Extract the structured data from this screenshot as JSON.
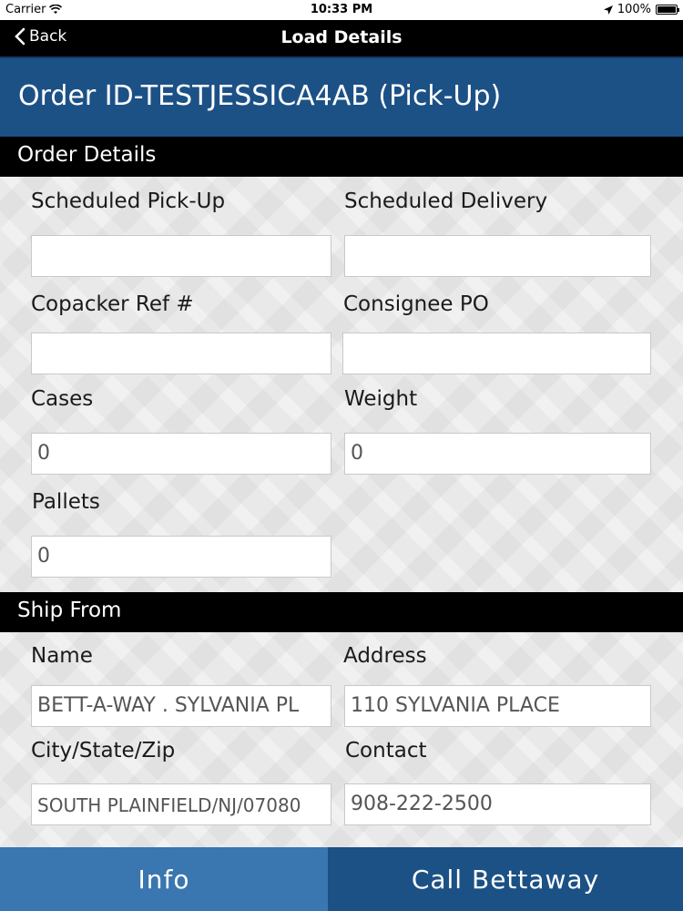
{
  "status_bar": {
    "carrier": "Carrier",
    "time": "10:33 PM",
    "battery": "100%",
    "battery_level": 1.0
  },
  "nav": {
    "back_label": "Back",
    "title": "Load Details"
  },
  "order": {
    "title": "Order ID-TESTJESSICA4AB  (Pick-Up)"
  },
  "order_details": {
    "header": "Order Details",
    "scheduled_pickup": {
      "label": "Scheduled Pick-Up",
      "value": ""
    },
    "scheduled_delivery": {
      "label": "Scheduled Delivery",
      "value": ""
    },
    "copacker_ref": {
      "label": "Copacker Ref #",
      "value": ""
    },
    "consignee_po": {
      "label": "Consignee PO",
      "value": ""
    },
    "cases": {
      "label": "Cases",
      "value": "0"
    },
    "weight": {
      "label": "Weight",
      "value": "0"
    },
    "pallets": {
      "label": "Pallets",
      "value": "0"
    }
  },
  "ship_from": {
    "header": "Ship From",
    "name": {
      "label": "Name",
      "value": "BETT-A-WAY .  SYLVANIA PL"
    },
    "address": {
      "label": "Address",
      "value": "110 SYLVANIA PLACE"
    },
    "city_state_zip": {
      "label": "City/State/Zip",
      "value": "SOUTH PLAINFIELD/NJ/07080"
    },
    "contact": {
      "label": "Contact",
      "value": "908-222-2500"
    }
  },
  "tabs": {
    "info": "Info",
    "call": "Call Bettaway"
  },
  "icons": [
    "wifi-icon",
    "location-arrow-icon",
    "battery-icon",
    "chevron-left-icon"
  ],
  "colors": {
    "header_blue": "#1c5186",
    "tab_info_blue": "#3a76b0",
    "tab_call_blue": "#1c5186"
  }
}
